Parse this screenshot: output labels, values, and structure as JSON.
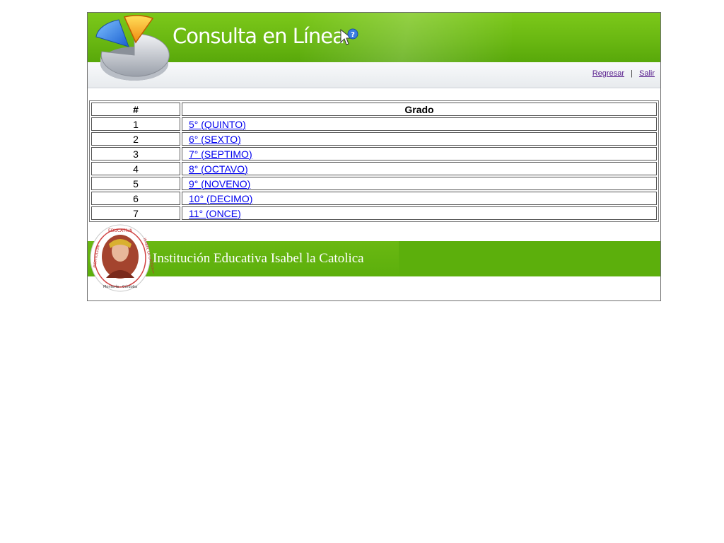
{
  "header": {
    "title": "Consulta en Línea",
    "nav": {
      "back": "Regresar",
      "separator": "|",
      "exit": "Salir"
    }
  },
  "table": {
    "columns": [
      "#",
      "Grado"
    ],
    "rows": [
      {
        "num": "1",
        "grade": "5° (QUINTO)"
      },
      {
        "num": "2",
        "grade": "6° (SEXTO)"
      },
      {
        "num": "3",
        "grade": "7° (SEPTIMO)"
      },
      {
        "num": "4",
        "grade": "8° (OCTAVO)"
      },
      {
        "num": "5",
        "grade": "9° (NOVENO)"
      },
      {
        "num": "6",
        "grade": "10° (DECIMO)"
      },
      {
        "num": "7",
        "grade": "11° (ONCE)"
      }
    ]
  },
  "footer": {
    "school_name": "Institución Educativa Isabel la Catolica",
    "seal_text_top": "EDUCATIVA",
    "seal_text_left": "INSTITUCIÓN",
    "seal_text_right": "ISABEL LA CATÓLICA",
    "seal_text_bottom": "Montería - Córdoba"
  },
  "colors": {
    "banner_green": "#6ab812",
    "link": "#0000ee",
    "visited_link": "#551a8b"
  }
}
